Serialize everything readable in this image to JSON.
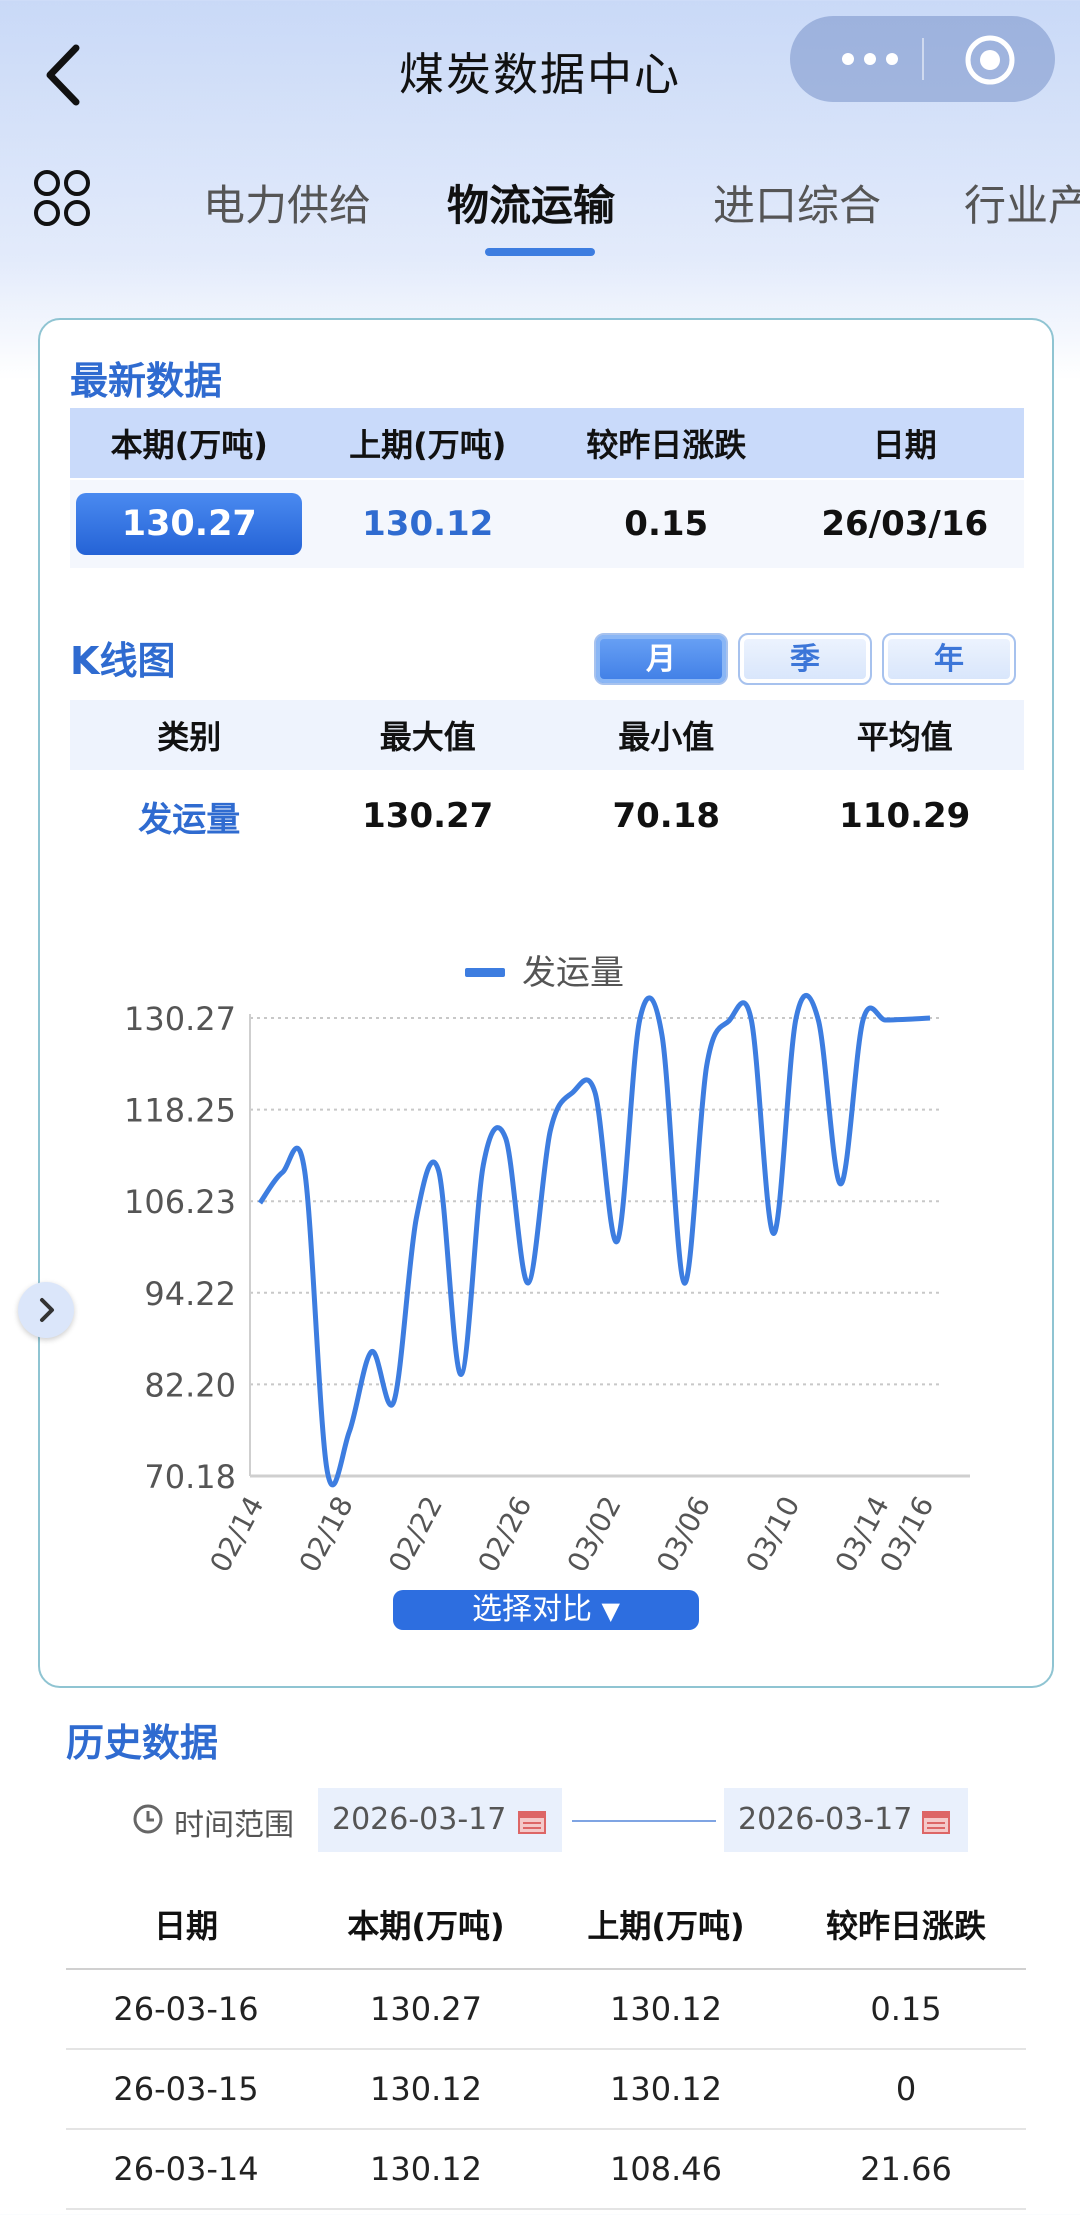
{
  "header": {
    "title": "煤炭数据中心"
  },
  "tabs": [
    {
      "label": "电力供给"
    },
    {
      "label": "物流运输"
    },
    {
      "label": "进口综合"
    },
    {
      "label": "行业产"
    }
  ],
  "latest": {
    "title": "最新数据",
    "headers": [
      "本期(万吨)",
      "上期(万吨)",
      "较昨日涨跌",
      "日期"
    ],
    "current": "130.27",
    "previous": "130.12",
    "change": "0.15",
    "date": "26/03/16"
  },
  "kline": {
    "title": "K线图",
    "periods": [
      {
        "label": "月",
        "selected": true
      },
      {
        "label": "季",
        "selected": false
      },
      {
        "label": "年",
        "selected": false
      }
    ],
    "headers": [
      "类别",
      "最大值",
      "最小值",
      "平均值"
    ],
    "category": "发运量",
    "max": "130.27",
    "min": "70.18",
    "avg": "110.29"
  },
  "chart_data": {
    "type": "line",
    "legend": [
      "发运量"
    ],
    "legend_placement": "top-center",
    "ylim": [
      70.18,
      130.27
    ],
    "y_ticks": [
      "130.27",
      "118.25",
      "106.23",
      "94.22",
      "82.20",
      "70.18"
    ],
    "x_ticks": [
      "02/14",
      "02/18",
      "02/22",
      "02/26",
      "03/02",
      "03/06",
      "03/10",
      "03/14",
      "03/16"
    ],
    "grid": true,
    "color": "#3d7de0",
    "series": [
      {
        "name": "发运量",
        "x": [
          "02/14",
          "02/15",
          "02/16",
          "02/17",
          "02/18",
          "02/19",
          "02/20",
          "02/21",
          "02/22",
          "02/23",
          "02/24",
          "02/25",
          "02/26",
          "02/27",
          "02/28",
          "03/01",
          "03/02",
          "03/03",
          "03/04",
          "03/05",
          "03/06",
          "03/07",
          "03/08",
          "03/09",
          "03/10",
          "03/11",
          "03/12",
          "03/13",
          "03/14",
          "03/15",
          "03/16"
        ],
        "values": [
          106.0,
          110.0,
          110.2,
          71.0,
          76.0,
          86.5,
          80.0,
          104.0,
          110.2,
          83.5,
          111.0,
          114.5,
          95.5,
          115.5,
          120.5,
          120.5,
          101.0,
          130.0,
          128.0,
          95.5,
          124.0,
          129.9,
          130.0,
          102.0,
          130.2,
          130.0,
          108.5,
          130.0,
          130.0,
          130.1,
          130.27
        ]
      }
    ]
  },
  "compare_button": "选择对比",
  "history": {
    "title": "历史数据",
    "range_label": "时间范围",
    "start_date": "2026-03-17",
    "end_date": "2026-03-17",
    "headers": [
      "日期",
      "本期(万吨)",
      "上期(万吨)",
      "较昨日涨跌"
    ],
    "rows": [
      [
        "26-03-16",
        "130.27",
        "130.12",
        "0.15"
      ],
      [
        "26-03-15",
        "130.12",
        "130.12",
        "0"
      ],
      [
        "26-03-14",
        "130.12",
        "108.46",
        "21.66"
      ]
    ]
  }
}
